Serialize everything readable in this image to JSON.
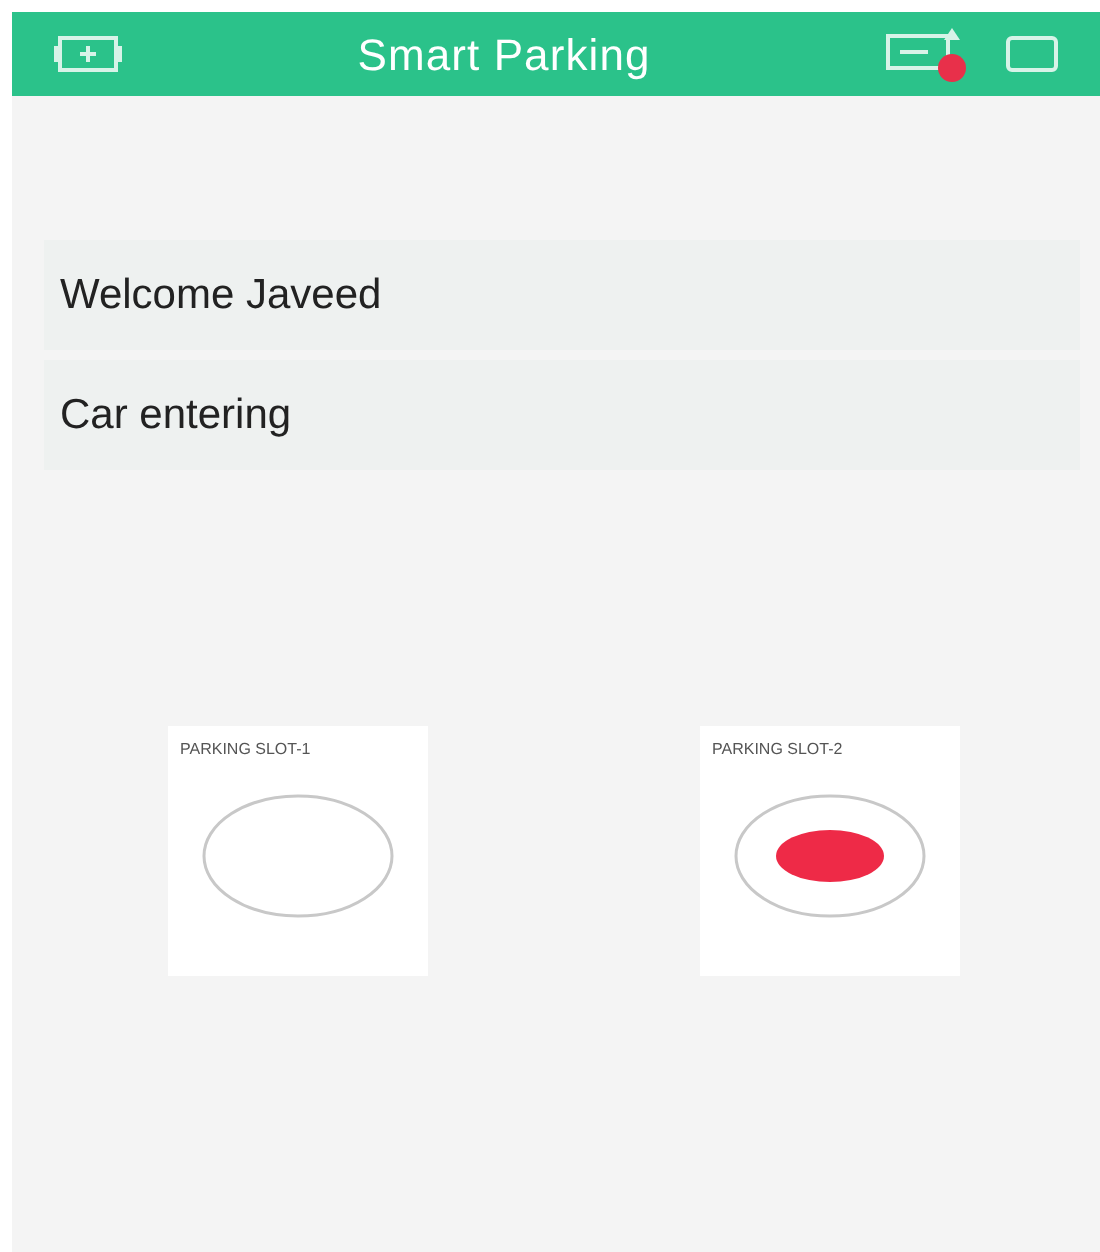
{
  "header": {
    "title": "Smart Parking",
    "notification": true
  },
  "labels": [
    "Welcome Javeed",
    "Car entering"
  ],
  "slots": [
    {
      "label": "PARKING SLOT-1",
      "on": false
    },
    {
      "label": "PARKING SLOT-2",
      "on": true
    }
  ]
}
